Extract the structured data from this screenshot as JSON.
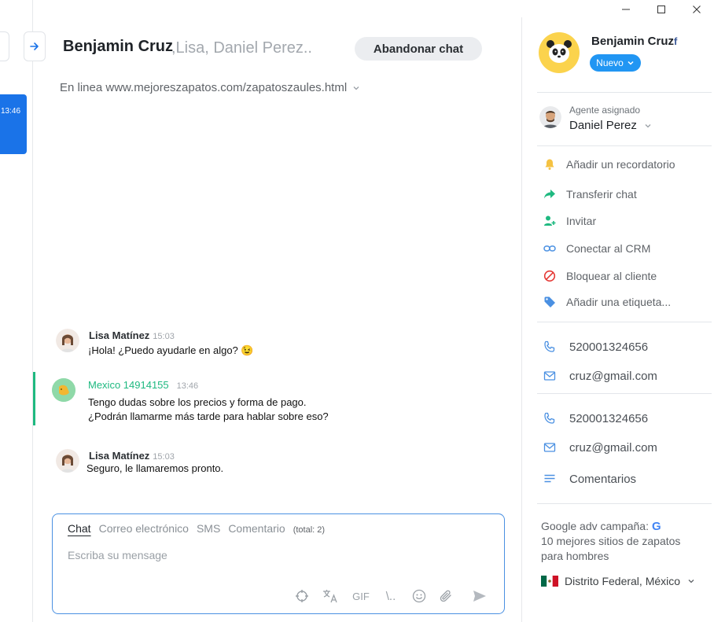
{
  "left_panel": {
    "active_time": "13:46"
  },
  "header": {
    "title": "Benjamin Cruz",
    "participants": ",Lisa, Daniel Perez..",
    "leave_button": "Abandonar chat",
    "status": "En linea www.mejoreszapatos.com/zapatoszaules.html"
  },
  "messages": [
    {
      "author": "Lisa Matínez",
      "time": "15:03",
      "text": "¡Hola! ¿Puedo ayudarle en algo?",
      "emoji": "😉"
    },
    {
      "author": "Mexico 14914155",
      "time": "13:46",
      "lines": [
        "Tengo dudas sobre los precios y forma de pago.",
        "¿Podrán llamarme más tarde para hablar sobre eso?"
      ]
    },
    {
      "author": "Lisa Matínez",
      "time": "15:03",
      "text": "Seguro, le llamaremos pronto."
    }
  ],
  "composer": {
    "tabs": [
      "Chat",
      "Correo electrónico",
      "SMS",
      "Comentario"
    ],
    "total": "(total: 2)",
    "placeholder": "Escriba su mensage",
    "gif_label": "GIF",
    "script_label": "\\.."
  },
  "profile": {
    "name": "Benjamin Cruz",
    "social": "f",
    "status_badge": "Nuevo",
    "agent_label": "Agente asignado",
    "agent_name": "Daniel Perez",
    "actions": [
      {
        "label": "Añadir un recordatorio",
        "icon": "bell-icon",
        "color": "#f5c242"
      },
      {
        "label": "Transferir chat",
        "icon": "share-arrow-icon",
        "color": "#1eb980"
      },
      {
        "label": "Invitar",
        "icon": "add-person-icon",
        "color": "#1eb980"
      },
      {
        "label": "Conectar al CRM",
        "icon": "link-icon",
        "color": "#4a90e2"
      },
      {
        "label": "Bloquear al cliente",
        "icon": "block-icon",
        "color": "#e53935"
      },
      {
        "label": "Añadir una etiqueta...",
        "icon": "tag-icon",
        "color": "#4a90e2"
      }
    ],
    "contacts": [
      {
        "phone": "520001324656",
        "email": "cruz@gmail.com"
      },
      {
        "phone": "520001324656",
        "email": "cruz@gmail.com"
      }
    ],
    "comments_label": "Comentarios",
    "campaign": "Google adv campaña:",
    "campaign_detail": "10 mejores sitios de zapatos para hombres",
    "location": "Distrito Federal, México"
  },
  "colors": {
    "accent": "#1a73e8",
    "customer": "#1eb980",
    "badge": "#2196f3"
  }
}
